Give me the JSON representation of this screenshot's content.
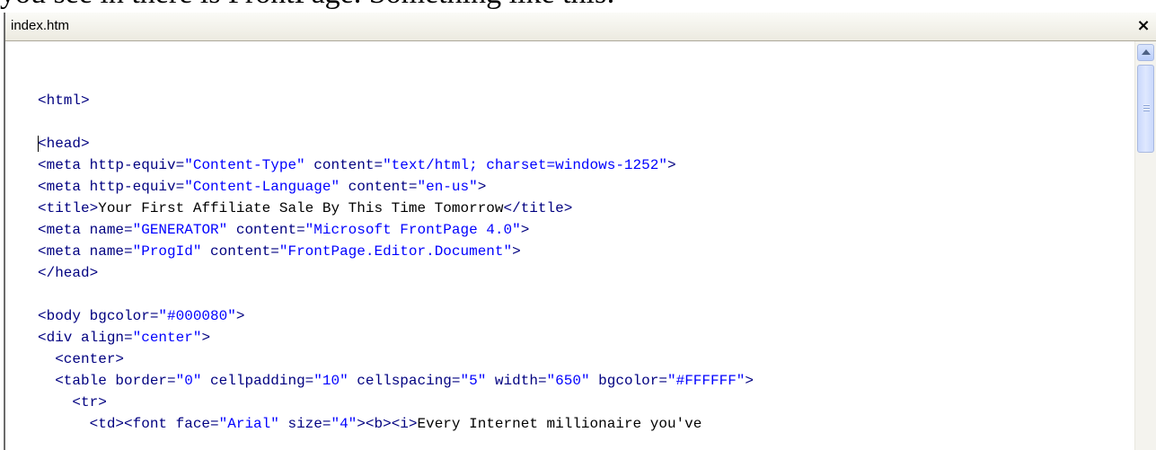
{
  "background_text": "you see in there is FrontPage. Something like this:",
  "tab": {
    "title": "index.htm",
    "close_glyph": "×"
  },
  "code": {
    "lines": [
      [
        {
          "t": "tag",
          "s": "<html>"
        }
      ],
      [],
      [
        {
          "t": "tag",
          "s": "<head>"
        }
      ],
      [
        {
          "t": "tag",
          "s": "<meta "
        },
        {
          "t": "attr",
          "s": "http-equiv="
        },
        {
          "t": "val",
          "s": "\"Content-Type\""
        },
        {
          "t": "attr",
          "s": " content="
        },
        {
          "t": "val",
          "s": "\"text/html; charset=windows-1252\""
        },
        {
          "t": "tag",
          "s": ">"
        }
      ],
      [
        {
          "t": "tag",
          "s": "<meta "
        },
        {
          "t": "attr",
          "s": "http-equiv="
        },
        {
          "t": "val",
          "s": "\"Content-Language\""
        },
        {
          "t": "attr",
          "s": " content="
        },
        {
          "t": "val",
          "s": "\"en-us\""
        },
        {
          "t": "tag",
          "s": ">"
        }
      ],
      [
        {
          "t": "tag",
          "s": "<title>"
        },
        {
          "t": "txt",
          "s": "Your First Affiliate Sale By This Time Tomorrow"
        },
        {
          "t": "tag",
          "s": "</title>"
        }
      ],
      [
        {
          "t": "tag",
          "s": "<meta "
        },
        {
          "t": "attr",
          "s": "name="
        },
        {
          "t": "val",
          "s": "\"GENERATOR\""
        },
        {
          "t": "attr",
          "s": " content="
        },
        {
          "t": "val",
          "s": "\"Microsoft FrontPage 4.0\""
        },
        {
          "t": "tag",
          "s": ">"
        }
      ],
      [
        {
          "t": "tag",
          "s": "<meta "
        },
        {
          "t": "attr",
          "s": "name="
        },
        {
          "t": "val",
          "s": "\"ProgId\""
        },
        {
          "t": "attr",
          "s": " content="
        },
        {
          "t": "val",
          "s": "\"FrontPage.Editor.Document\""
        },
        {
          "t": "tag",
          "s": ">"
        }
      ],
      [
        {
          "t": "tag",
          "s": "</head>"
        }
      ],
      [],
      [
        {
          "t": "tag",
          "s": "<body "
        },
        {
          "t": "attr",
          "s": "bgcolor="
        },
        {
          "t": "val",
          "s": "\"#000080\""
        },
        {
          "t": "tag",
          "s": ">"
        }
      ],
      [
        {
          "t": "tag",
          "s": "<div "
        },
        {
          "t": "attr",
          "s": "align="
        },
        {
          "t": "val",
          "s": "\"center\""
        },
        {
          "t": "tag",
          "s": ">"
        }
      ],
      [
        {
          "t": "txt",
          "s": "  "
        },
        {
          "t": "tag",
          "s": "<center>"
        }
      ],
      [
        {
          "t": "txt",
          "s": "  "
        },
        {
          "t": "tag",
          "s": "<table "
        },
        {
          "t": "attr",
          "s": "border="
        },
        {
          "t": "val",
          "s": "\"0\""
        },
        {
          "t": "attr",
          "s": " cellpadding="
        },
        {
          "t": "val",
          "s": "\"10\""
        },
        {
          "t": "attr",
          "s": " cellspacing="
        },
        {
          "t": "val",
          "s": "\"5\""
        },
        {
          "t": "attr",
          "s": " width="
        },
        {
          "t": "val",
          "s": "\"650\""
        },
        {
          "t": "attr",
          "s": " bgcolor="
        },
        {
          "t": "val",
          "s": "\"#FFFFFF\""
        },
        {
          "t": "tag",
          "s": ">"
        }
      ],
      [
        {
          "t": "txt",
          "s": "    "
        },
        {
          "t": "tag",
          "s": "<tr>"
        }
      ],
      [
        {
          "t": "txt",
          "s": "      "
        },
        {
          "t": "tag",
          "s": "<td><font "
        },
        {
          "t": "attr",
          "s": "face="
        },
        {
          "t": "val",
          "s": "\"Arial\""
        },
        {
          "t": "attr",
          "s": " size="
        },
        {
          "t": "val",
          "s": "\"4\""
        },
        {
          "t": "tag",
          "s": "><b><i>"
        },
        {
          "t": "txt",
          "s": "Every Internet millionaire you've"
        }
      ]
    ],
    "caret_line": 2
  },
  "colors": {
    "tag": "#000080",
    "value": "#0000ff",
    "text": "#000000",
    "scroll_accent": "#b9cdfb"
  },
  "icons": {
    "close": "close-icon",
    "scroll_up": "chevron-up-icon"
  }
}
